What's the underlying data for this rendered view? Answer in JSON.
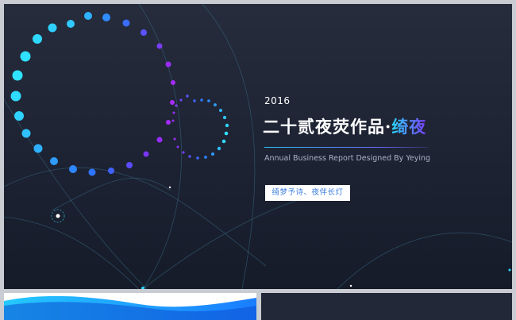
{
  "slide": {
    "year": "2016",
    "title_main": "二十贰夜荧作品·",
    "title_accent": "绮夜",
    "subtitle": "Annual Business Report Designed By Yeying",
    "tag": "绮梦予诗、夜伴长灯"
  },
  "colors": {
    "background": "#1f2535",
    "accent_cyan": "#2ad8ff",
    "accent_blue": "#2f6cff",
    "accent_purple": "#9a2cff",
    "tag_text": "#3b7de0"
  },
  "icons": [
    "dotted-circle-large",
    "dotted-circle-small",
    "orbit-lines"
  ]
}
